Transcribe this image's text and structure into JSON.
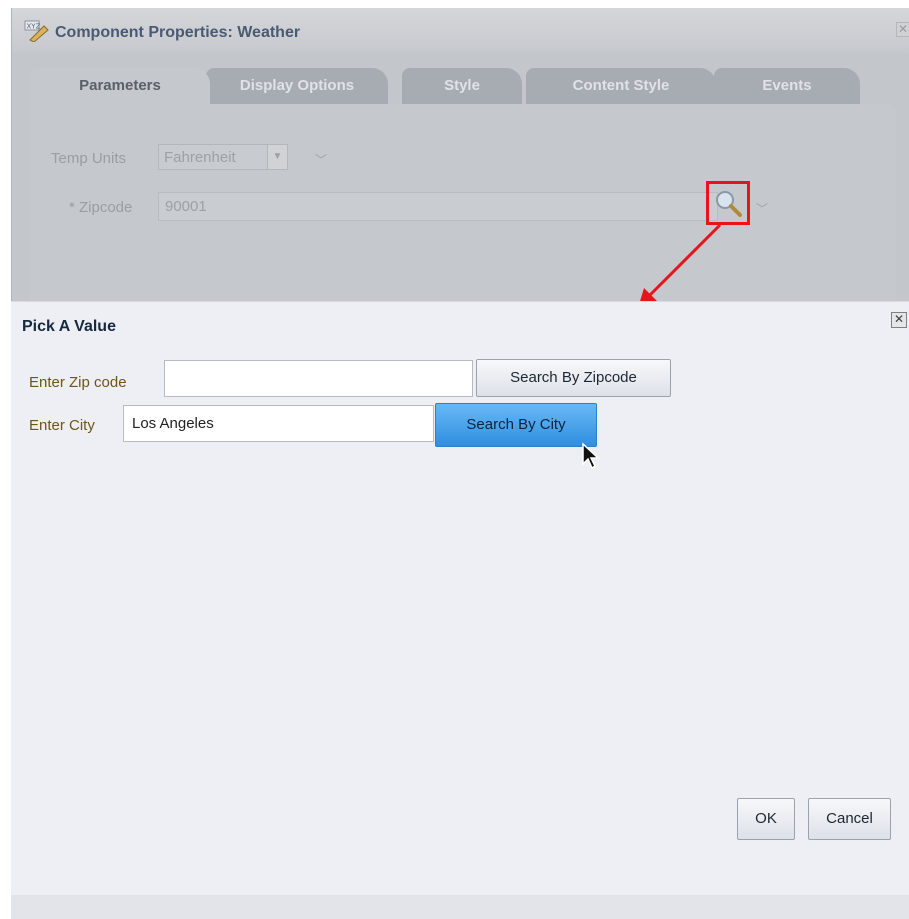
{
  "props_dialog": {
    "title": "Component Properties: Weather",
    "close_glyph": "✕",
    "tabs": [
      {
        "label": "Parameters",
        "active": true
      },
      {
        "label": "Display Options",
        "active": false
      },
      {
        "label": "Style",
        "active": false
      },
      {
        "label": "Content Style",
        "active": false
      },
      {
        "label": "Events",
        "active": false
      }
    ],
    "temp_units": {
      "label": "Temp Units",
      "value": "Fahrenheit"
    },
    "zipcode": {
      "label": "* Zipcode",
      "value": "90001"
    },
    "icons": {
      "app": "component-icon",
      "search": "magnifier-icon",
      "chevron": "chevron-down-icon"
    },
    "highlight_color": "#e8141c"
  },
  "pick_dialog": {
    "title": "Pick A Value",
    "close_glyph": "✕",
    "zip_row": {
      "label": "Enter Zip code",
      "value": "",
      "button": "Search By Zipcode"
    },
    "city_row": {
      "label": "Enter City",
      "value": "Los Angeles",
      "button": "Search By City"
    },
    "ok_button": "OK",
    "cancel_button": "Cancel",
    "accent_color": "#2f8fe0"
  }
}
